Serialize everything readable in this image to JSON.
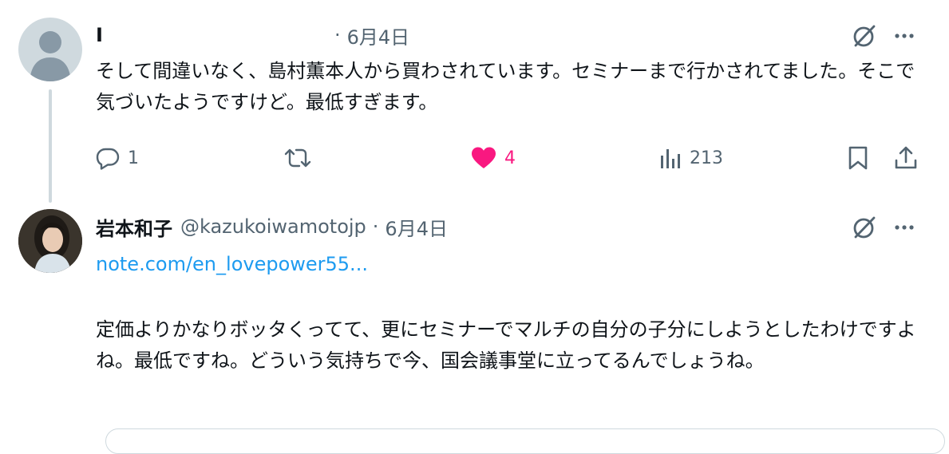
{
  "tweet1": {
    "name": "I",
    "date": "6月4日",
    "text": "そして間違いなく、島村薫本人から買わされています。セミナーまで行かされてました。そこで気づいたようですけど。最低すぎます。",
    "actions": {
      "reply_count": "1",
      "retweet_count": "",
      "like_count": "4",
      "views_count": "213"
    },
    "liked": true
  },
  "tweet2": {
    "name": "岩本和子",
    "handle": "@kazukoiwamotojp",
    "separator": "·",
    "date": "6月4日",
    "link": "note.com/en_lovepower55...",
    "text": "定価よりかなりボッタくってて、更にセミナーでマルチの自分の子分にしようとしたわけですよね。最低ですね。どういう気持ちで今、国会議事堂に立ってるんでしょうね。"
  },
  "icons": [
    "grok-icon",
    "more-icon",
    "reply-icon",
    "retweet-icon",
    "heart-icon",
    "views-icon",
    "bookmark-icon",
    "share-icon"
  ],
  "colors": {
    "like": "#f91880",
    "link": "#1d9bf0",
    "muted": "#536471",
    "line": "#cfd9de"
  }
}
